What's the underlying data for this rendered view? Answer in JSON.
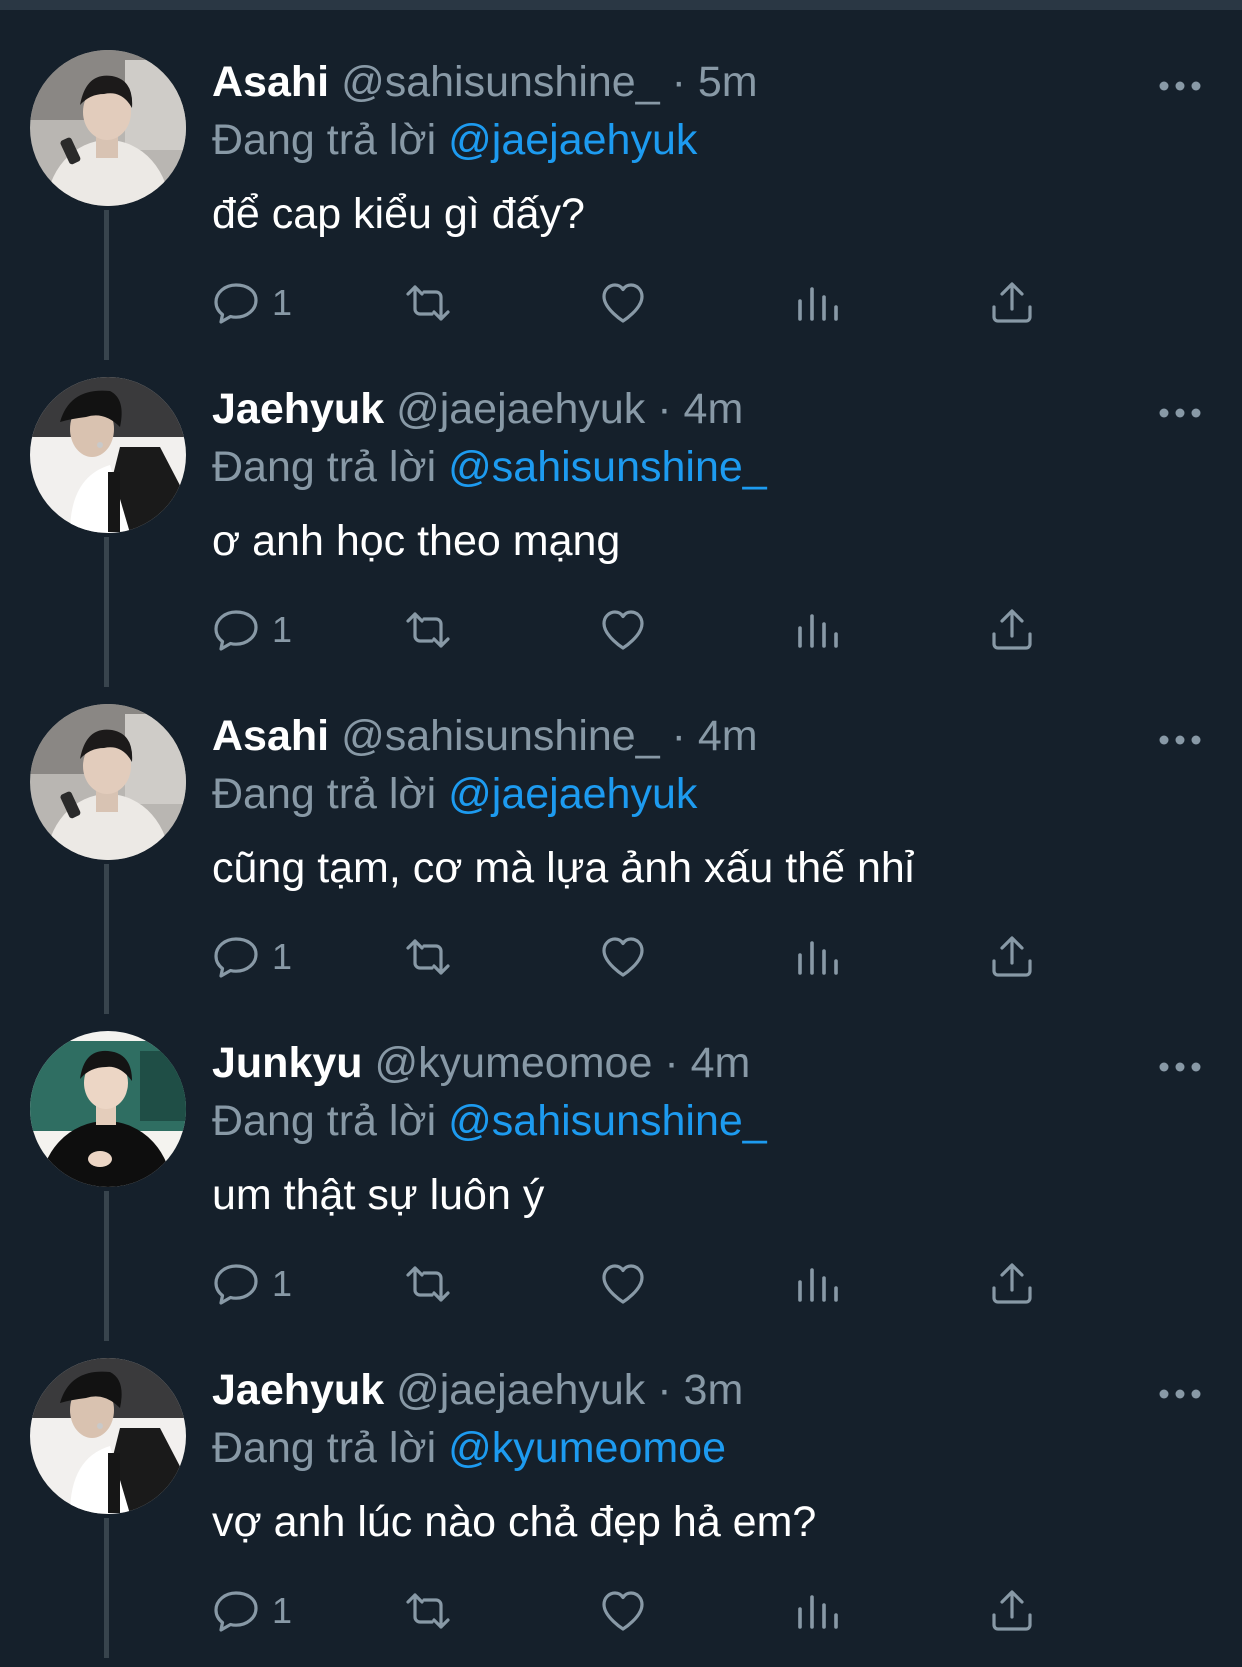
{
  "colors": {
    "background": "#15202b",
    "muted": "#8899a6",
    "mention": "#1d9bf0",
    "thread_line": "#38444d"
  },
  "icons": {
    "more": "ellipsis-icon",
    "reply": "reply-icon",
    "retweet": "retweet-icon",
    "like": "heart-icon",
    "analytics": "analytics-icon",
    "share": "share-icon"
  },
  "tweets": [
    {
      "name": "Asahi",
      "handle": "@sahisunshine_",
      "sep": "·",
      "time": "5m",
      "reply_prefix": "Đang trả lời",
      "reply_to": "@jaejaehyuk",
      "text": "để cap kiểu gì đấy?",
      "reply_count": "1"
    },
    {
      "name": "Jaehyuk",
      "handle": "@jaejaehyuk",
      "sep": "·",
      "time": "4m",
      "reply_prefix": "Đang trả lời",
      "reply_to": "@sahisunshine_",
      "text": "ơ anh học theo mạng",
      "reply_count": "1"
    },
    {
      "name": "Asahi",
      "handle": "@sahisunshine_",
      "sep": "·",
      "time": "4m",
      "reply_prefix": "Đang trả lời",
      "reply_to": "@jaejaehyuk",
      "text": "cũng tạm, cơ mà lựa ảnh xấu thế nhỉ",
      "reply_count": "1"
    },
    {
      "name": "Junkyu",
      "handle": "@kyumeomoe",
      "sep": "·",
      "time": "4m",
      "reply_prefix": "Đang trả lời",
      "reply_to": "@sahisunshine_",
      "text": "um thật sự luôn ý",
      "reply_count": "1"
    },
    {
      "name": "Jaehyuk",
      "handle": "@jaejaehyuk",
      "sep": "·",
      "time": "3m",
      "reply_prefix": "Đang trả lời",
      "reply_to": "@kyumeomoe",
      "text": "vợ anh lúc nào chả đẹp hả em?",
      "reply_count": "1"
    }
  ]
}
